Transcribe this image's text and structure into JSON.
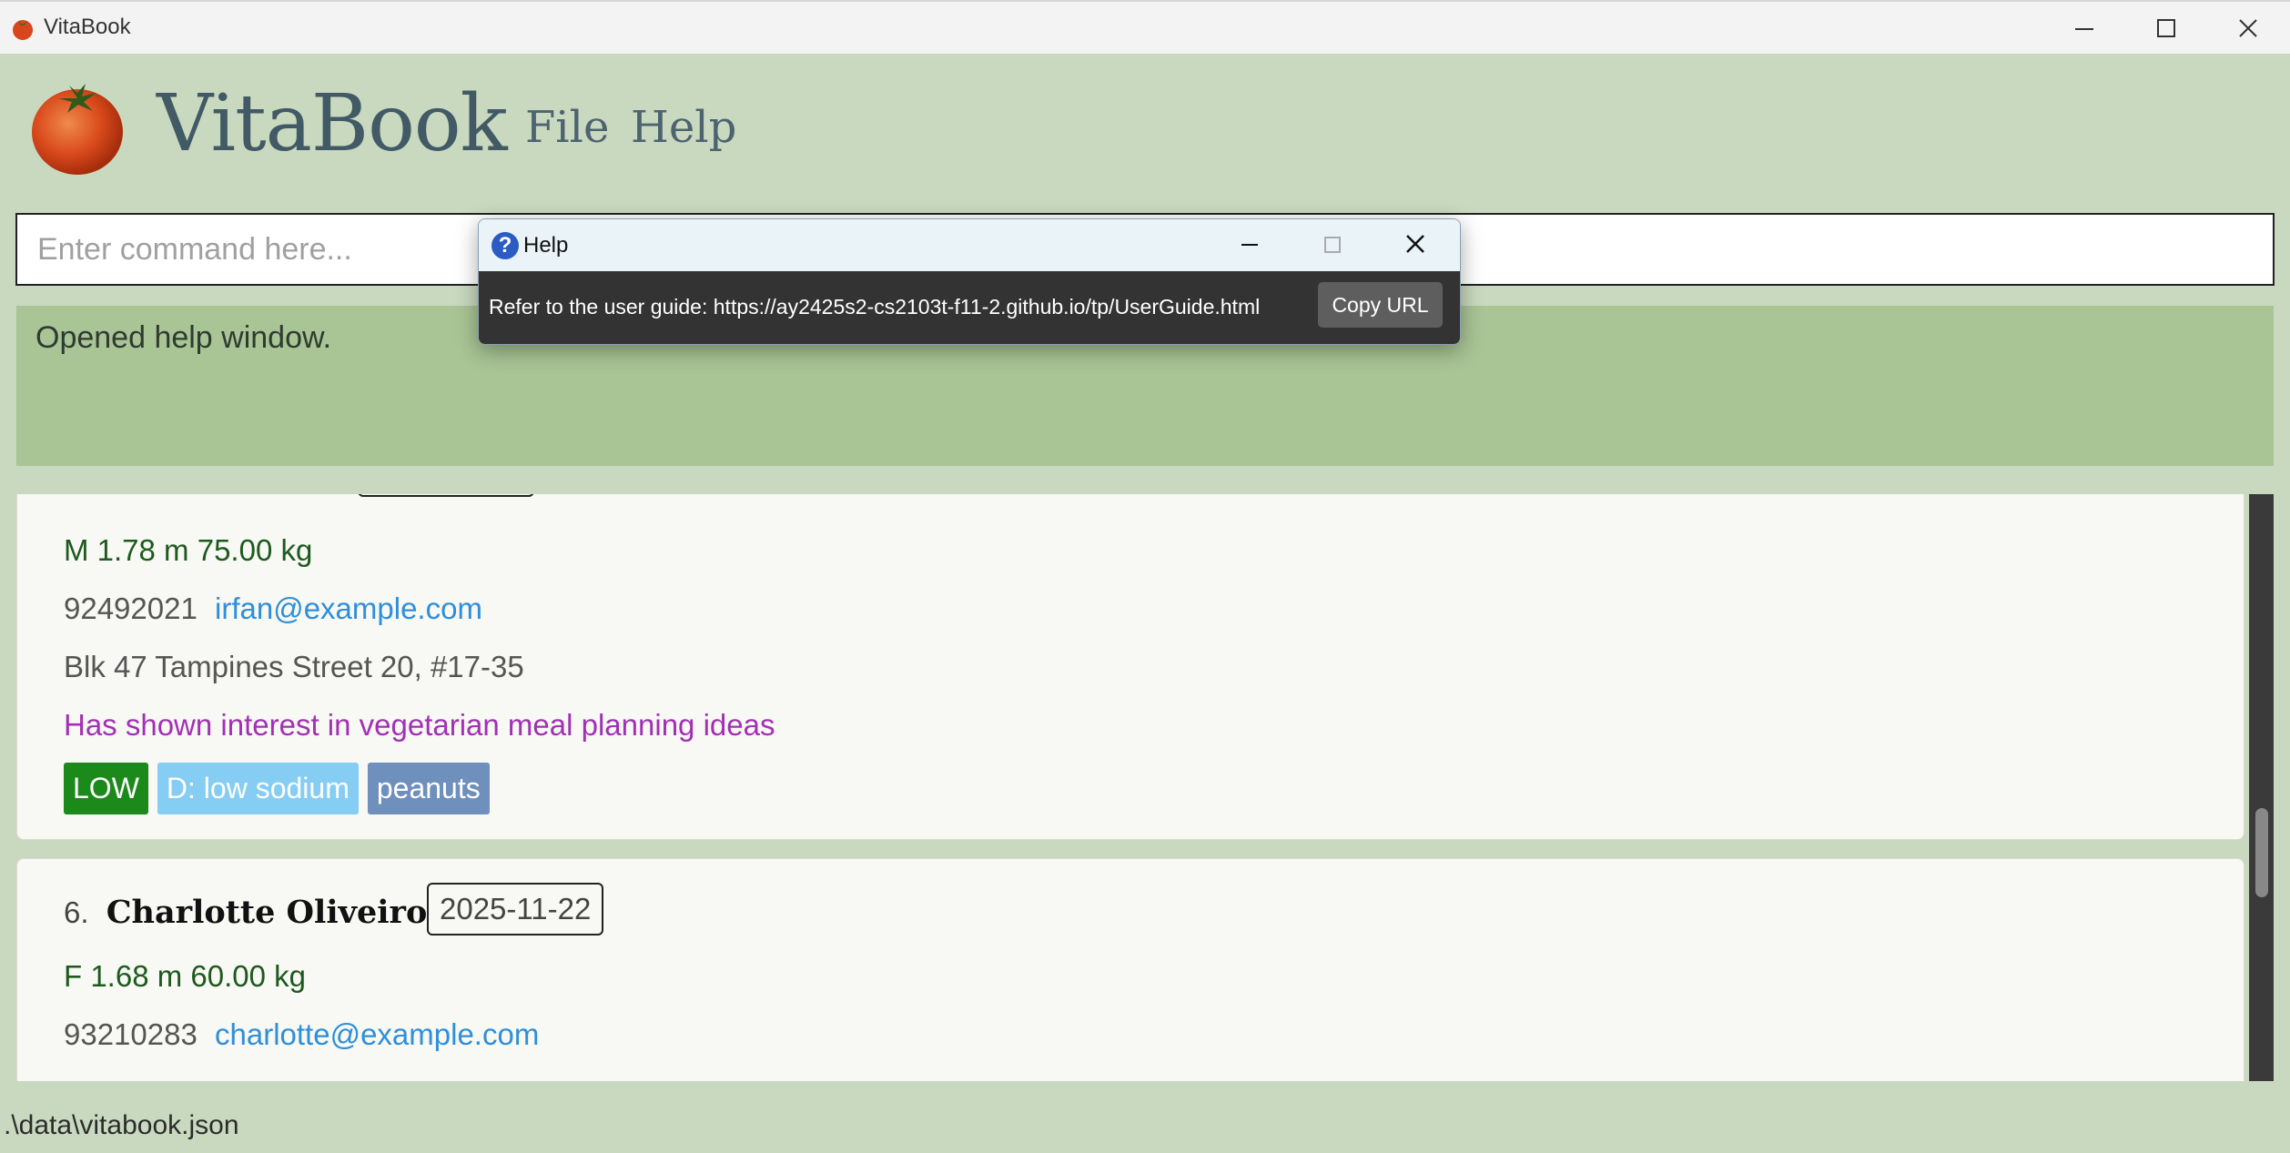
{
  "window": {
    "title": "VitaBook"
  },
  "header": {
    "brand": "VitaBook",
    "menu": [
      "File",
      "Help"
    ]
  },
  "command": {
    "placeholder": "Enter command here..."
  },
  "result": {
    "text": "Opened help window."
  },
  "persons": [
    {
      "vitals": "M  1.78 m  75.00 kg",
      "phone": "92492021",
      "email": "irfan@example.com",
      "address": "Blk 47 Tampines Street 20, #17-35",
      "note": "Has shown interest in vegetarian meal planning ideas",
      "tags": [
        "LOW",
        "D: low sodium",
        "peanuts"
      ]
    },
    {
      "index": "6.",
      "name": "Charlotte Oliveiro",
      "date": "2025-11-22",
      "vitals": "F  1.68 m  60.00 kg",
      "phone": "93210283",
      "email": "charlotte@example.com"
    }
  ],
  "status": {
    "path": ".\\data\\vitabook.json"
  },
  "help_dialog": {
    "title": "Help",
    "message": "Refer to the user guide: https://ay2425s2-cs2103t-f11-2.github.io/tp/UserGuide.html",
    "copy_label": "Copy URL"
  },
  "colors": {
    "background": "#c8d9bf",
    "result_bg": "#a9c495",
    "brand": "#415a66",
    "tag_low": "#1b8a1b",
    "tag_diet": "#86cdf3",
    "tag_allergy": "#6f8fbc"
  }
}
